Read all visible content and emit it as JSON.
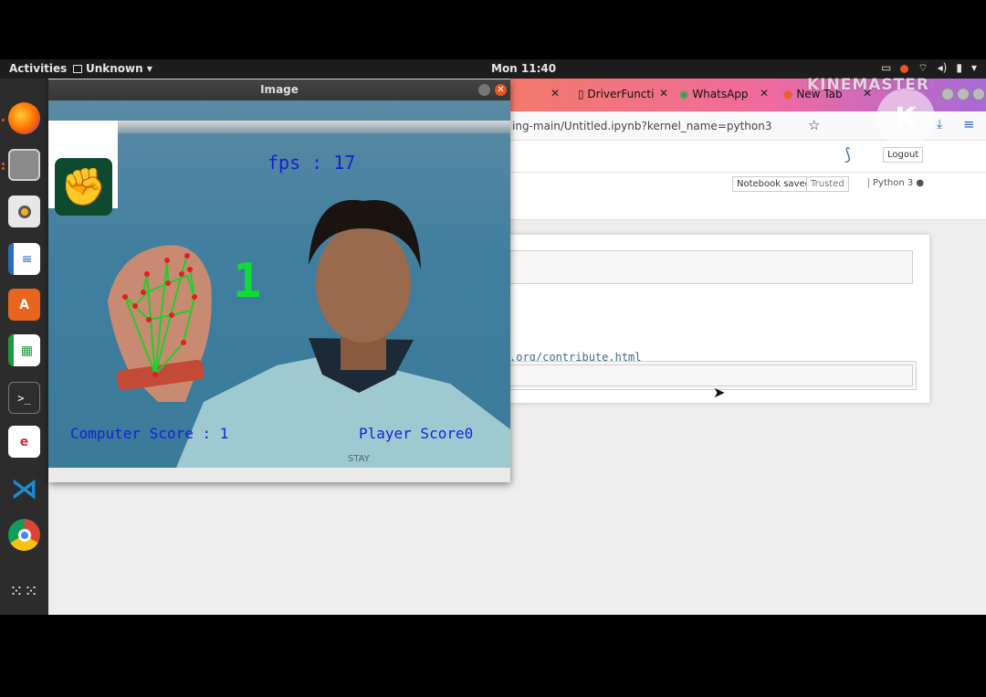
{
  "topbar": {
    "activities": "Activities",
    "app_menu": "Unknown",
    "clock": "Mon 11:40"
  },
  "dock": {
    "items": [
      "firefox-icon",
      "files-icon",
      "rhythmbox-icon",
      "writer-icon",
      "software-icon",
      "calc-icon",
      "terminal-icon",
      "evince-icon",
      "vscode-icon",
      "chrome-icon",
      "apps-grid-icon"
    ]
  },
  "browser": {
    "tabs": [
      {
        "label": "DriverFuncti"
      },
      {
        "label": "WhatsApp"
      },
      {
        "label": "New Tab"
      }
    ],
    "url": "ing-main/Untitled.ipynb?kernel_name=python3",
    "logout_label": "Logout",
    "notebook_saved": "Notebook saved",
    "trusted": "Trusted",
    "kernel": "Python 3",
    "cell_link": ".org/contribute.html"
  },
  "watermark": {
    "text": "KINEMASTER",
    "badge": "K"
  },
  "image_window": {
    "title": "Image",
    "fps_text": "fps : 17",
    "countdown": "1",
    "computer_score": "Computer Score : 1",
    "player_score": "Player Score0",
    "shirt_text": "STAY",
    "gesture_icon": "fist-icon"
  },
  "colors": {
    "overlay_blue": "#1620d8",
    "overlay_green": "#0fdc34",
    "gesture_bg": "#0d4a2f",
    "ubuntu_orange": "#e95420"
  }
}
